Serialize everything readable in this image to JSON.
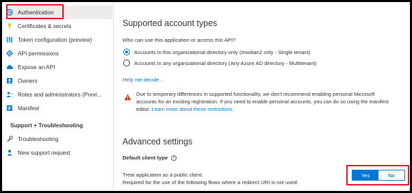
{
  "sidebar": {
    "items": [
      {
        "label": "Authentication",
        "icon": "authentication-icon"
      },
      {
        "label": "Certificates & secrets",
        "icon": "key-icon"
      },
      {
        "label": "Token configuration (preview)",
        "icon": "token-icon"
      },
      {
        "label": "API permissions",
        "icon": "api-permissions-icon"
      },
      {
        "label": "Expose an API",
        "icon": "cloud-icon"
      },
      {
        "label": "Owners",
        "icon": "owners-icon"
      },
      {
        "label": "Roles and administrators (Previ...",
        "icon": "roles-icon"
      },
      {
        "label": "Manifest",
        "icon": "manifest-icon"
      }
    ],
    "section_support": "Support + Troubleshooting",
    "support_items": [
      {
        "label": "Troubleshooting",
        "icon": "wrench-icon"
      },
      {
        "label": "New support request",
        "icon": "person-icon"
      }
    ]
  },
  "account_types": {
    "heading": "Supported account types",
    "question": "Who can use this application or access this API?",
    "options": [
      {
        "label": "Accounts in this organizational directory only (mwtitan2 only - Single tenant)",
        "selected": true
      },
      {
        "label": "Accounts in any organizational directory (Any Azure AD directory - Multitenant)",
        "selected": false
      }
    ],
    "help_link": "Help me decide...",
    "warning_line1": "Due to temporary differences in supported functionality, we don't recommend enabling personal Microsoft",
    "warning_line2": "accounts for an existing registration. If you need to enable personal accounts, you can do so using the manifest",
    "warning_line3_prefix": "editor. ",
    "warning_link": "Learn more about these restrictions."
  },
  "advanced": {
    "heading": "Advanced settings",
    "default_client_type": "Default client type",
    "public_client_line1": "Treat application as a public client.",
    "public_client_line2": "Required for the use of the following flows where a redirect URI is not used:",
    "toggle_yes": "Yes",
    "toggle_no": "No",
    "toggle_value": "Yes"
  },
  "colors": {
    "accent": "#0078d4",
    "highlight_box": "#e81123",
    "warning": "#d83b01"
  }
}
